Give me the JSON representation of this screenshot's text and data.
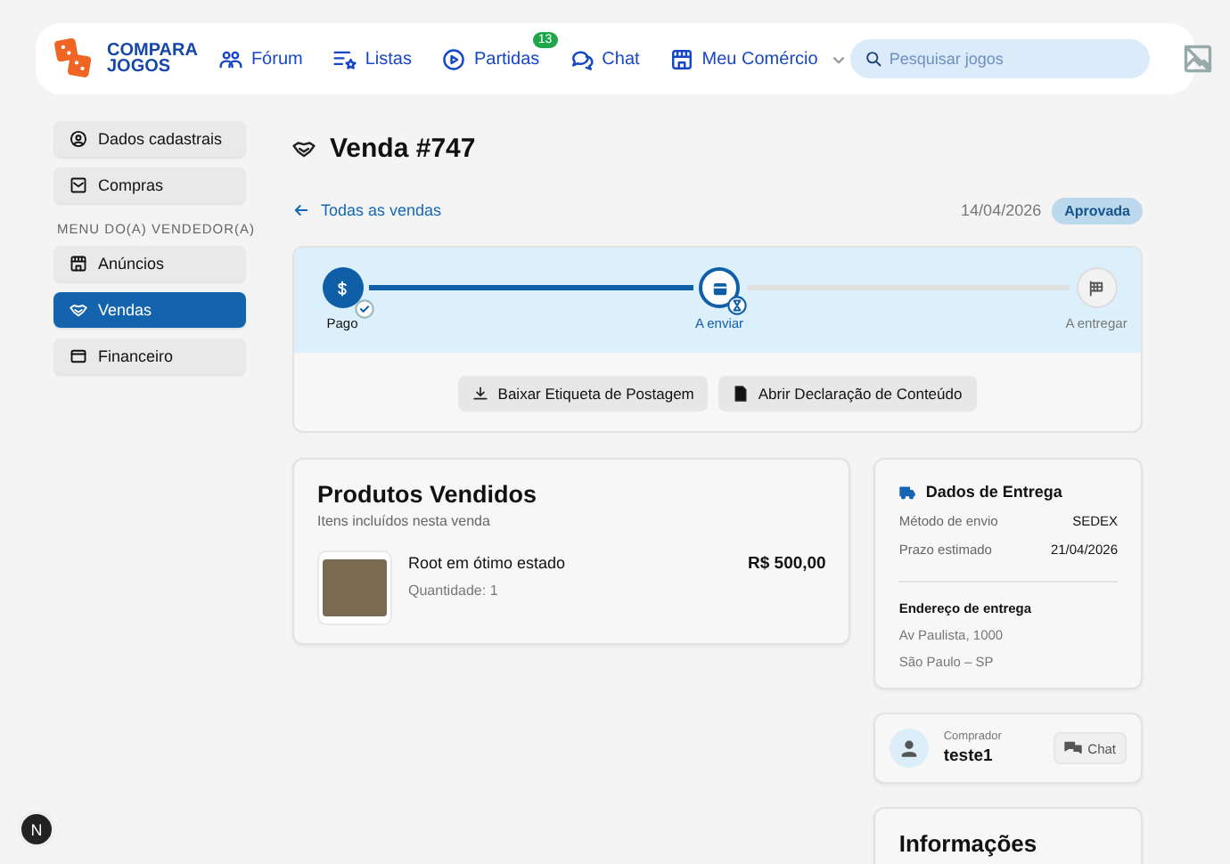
{
  "header": {
    "logo_line_1": "COMPARA",
    "logo_line_2": "JOGOS",
    "nav": [
      {
        "kind": "forum",
        "label": "Fórum"
      },
      {
        "kind": "lists",
        "label": "Listas"
      },
      {
        "kind": "play",
        "label": "Partidas",
        "badge": "13"
      },
      {
        "kind": "chat",
        "label": "Chat"
      },
      {
        "kind": "store",
        "label": "Meu Comércio",
        "dropdown": true
      }
    ],
    "search": {
      "placeholder": "Pesquisar jogos"
    }
  },
  "sidebar": {
    "items": [
      {
        "kind": "user",
        "label": "Dados cadastrais",
        "selected": false
      },
      {
        "kind": "inbox",
        "label": "Compras",
        "selected": false
      }
    ],
    "section_title": "MENU DO(A) VENDEDOR(A)",
    "seller_items": [
      {
        "kind": "store",
        "label": "Anúncios",
        "selected": false
      },
      {
        "kind": "handshake",
        "label": "Vendas",
        "selected": true
      },
      {
        "kind": "wallet",
        "label": "Financeiro",
        "selected": false
      }
    ]
  },
  "page": {
    "title": "Venda #747",
    "back_link": "Todas as vendas",
    "date": "14/04/2026",
    "status": "Aprovada"
  },
  "steps": [
    {
      "kind": "dollar",
      "label": "Pago",
      "completed": true,
      "current": false
    },
    {
      "kind": "box",
      "label": "A enviar",
      "completed": false,
      "current": true
    },
    {
      "kind": "flag",
      "label": "A entregar",
      "completed": false,
      "current": false
    }
  ],
  "actions": [
    {
      "kind": "download",
      "label": "Baixar Etiqueta de Postagem"
    },
    {
      "kind": "document",
      "label": "Abrir Declaração de Conteúdo"
    }
  ],
  "products": {
    "title": "Produtos Vendidos",
    "subtitle": "Itens incluídos nesta venda",
    "items": [
      {
        "name": "Root em ótimo estado",
        "quantity": "Quantidade: 1",
        "price": "R$ 500,00"
      }
    ]
  },
  "delivery": {
    "title": "Dados de Entrega",
    "rows": [
      {
        "label": "Método de envio",
        "value": "SEDEX"
      },
      {
        "label": "Prazo estimado",
        "value": "21/04/2026"
      }
    ],
    "address_title": "Endereço de entrega",
    "address_lines": [
      "Av Paulista, 1000",
      "São Paulo – SP"
    ]
  },
  "buyer": {
    "caption": "Comprador",
    "name": "teste1",
    "chat_button": "Chat"
  },
  "info": {
    "title": "Informações"
  },
  "dev_badge": "N"
}
